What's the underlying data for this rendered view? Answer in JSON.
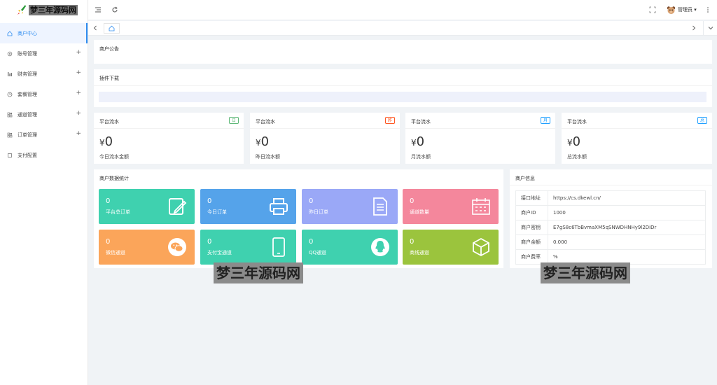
{
  "sidebar": {
    "logo_text": "梦三年源码网",
    "items": [
      {
        "label": "商户中心",
        "icon": "home-icon",
        "expandable": false
      },
      {
        "label": "账号管理",
        "icon": "gear-icon",
        "expandable": true
      },
      {
        "label": "财务管理",
        "icon": "bars-icon",
        "expandable": true
      },
      {
        "label": "套餐管理",
        "icon": "clock-icon",
        "expandable": true
      },
      {
        "label": "通道管理",
        "icon": "grid-icon",
        "expandable": true
      },
      {
        "label": "订单管理",
        "icon": "grid-icon",
        "expandable": true
      },
      {
        "label": "支付配置",
        "icon": "square-icon",
        "expandable": false
      }
    ],
    "plus": "+"
  },
  "header": {
    "admin_name": "管理员",
    "caret": "▾"
  },
  "announcement": {
    "title": "商户公告"
  },
  "plugin": {
    "title": "插件下载"
  },
  "stats": [
    {
      "title": "平台流水",
      "tag": "日",
      "value": "0",
      "label": "今日流水金额",
      "tag_color": "#5fb878"
    },
    {
      "title": "平台流水",
      "tag": "昨",
      "value": "0",
      "label": "昨日流水额",
      "tag_color": "#ff5722"
    },
    {
      "title": "平台流水",
      "tag": "月",
      "value": "0",
      "label": "月流水额",
      "tag_color": "#1e9fff"
    },
    {
      "title": "平台流水",
      "tag": "总",
      "value": "0",
      "label": "总流水额",
      "tag_color": "#1e9fff"
    }
  ],
  "currency": "¥",
  "merchant_stats": {
    "title": "商户数据统计",
    "tiles": [
      {
        "value": "0",
        "label": "平台总订单",
        "icon": "edit-icon",
        "color": "#3fd1af"
      },
      {
        "value": "0",
        "label": "今日订单",
        "icon": "printer-icon",
        "color": "#55a3ea"
      },
      {
        "value": "0",
        "label": "昨日订单",
        "icon": "document-icon",
        "color": "#9aa8f7"
      },
      {
        "value": "0",
        "label": "通道数量",
        "icon": "calendar-icon",
        "color": "#f4879c"
      },
      {
        "value": "0",
        "label": "微信通道",
        "icon": "wechat-icon",
        "color": "#fba55a"
      },
      {
        "value": "0",
        "label": "支付宝通道",
        "icon": "tablet-icon",
        "color": "#3fd1af"
      },
      {
        "value": "0",
        "label": "QQ通道",
        "icon": "qq-icon",
        "color": "#3fd1af"
      },
      {
        "value": "0",
        "label": "商线通道",
        "icon": "box-icon",
        "color": "#9bc43d"
      }
    ]
  },
  "merchant_info": {
    "title": "商户信息",
    "rows": [
      {
        "key": "接口地址",
        "value": "https://cs.dkewl.cn/"
      },
      {
        "key": "商户ID",
        "value": "1000"
      },
      {
        "key": "商户密钥",
        "value": "E7gS8c6TbBvmaXM5qSNWDHNHy9l2DiDr"
      },
      {
        "key": "商户余额",
        "value": "0.000"
      },
      {
        "key": "商户费率",
        "value": "%"
      }
    ]
  },
  "watermarks": [
    "梦三年源码网",
    "梦三年源码网"
  ]
}
